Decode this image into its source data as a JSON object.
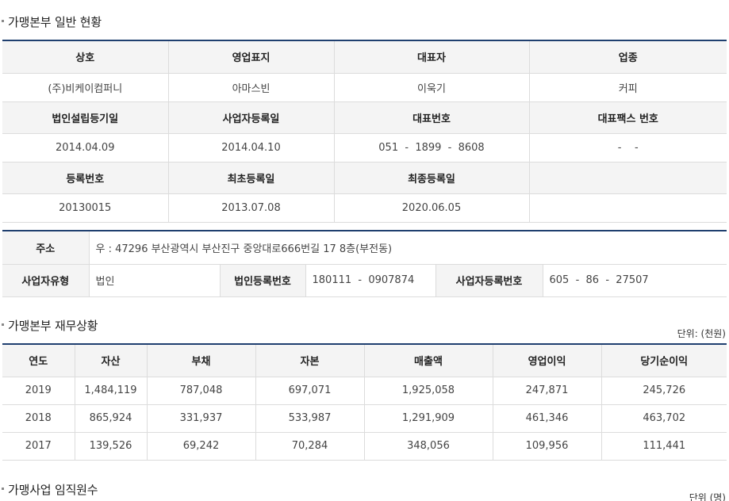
{
  "section1": {
    "title": "가맹본부 일반 현황",
    "headers_row1": [
      "상호",
      "영업표지",
      "대표자",
      "업종"
    ],
    "values_row1": [
      "(주)비케이컴퍼니",
      "아마스빈",
      "이욱기",
      "커피"
    ],
    "headers_row2": [
      "법인설립등기일",
      "사업자등록일",
      "대표번호",
      "대표팩스 번호"
    ],
    "values_row2": [
      "2014.04.09",
      "2014.04.10",
      "051  -  1899  -  8608",
      "  -    -  "
    ],
    "headers_row3": [
      "등록번호",
      "최초등록일",
      "최종등록일",
      ""
    ],
    "values_row3": [
      "20130015",
      "2013.07.08",
      "2020.06.05",
      ""
    ]
  },
  "address": {
    "label": "주소",
    "value": "우 : 47296 부산광역시 부산진구 중앙대로666번길 17 8층(부전동)",
    "biz_type_label": "사업자유형",
    "biz_type_value": "법인",
    "corp_reg_label": "법인등록번호",
    "corp_reg_value": "180111  -  0907874",
    "biz_reg_label": "사업자등록번호",
    "biz_reg_value": "605  -  86  -  27507"
  },
  "section2": {
    "title": "가맹본부 재무상황",
    "unit": "단위: (천원)",
    "headers": [
      "연도",
      "자산",
      "부채",
      "자본",
      "매출액",
      "영업이익",
      "당기순이익"
    ],
    "rows": [
      [
        "2019",
        "1,484,119",
        "787,048",
        "697,071",
        "1,925,058",
        "247,871",
        "245,726"
      ],
      [
        "2018",
        "865,924",
        "331,937",
        "533,987",
        "1,291,909",
        "461,346",
        "463,702"
      ],
      [
        "2017",
        "139,526",
        "69,242",
        "70,284",
        "348,056",
        "109,956",
        "111,441"
      ]
    ]
  },
  "section3": {
    "title": "가맹사업 임직원수",
    "unit": "단위 (명)"
  }
}
